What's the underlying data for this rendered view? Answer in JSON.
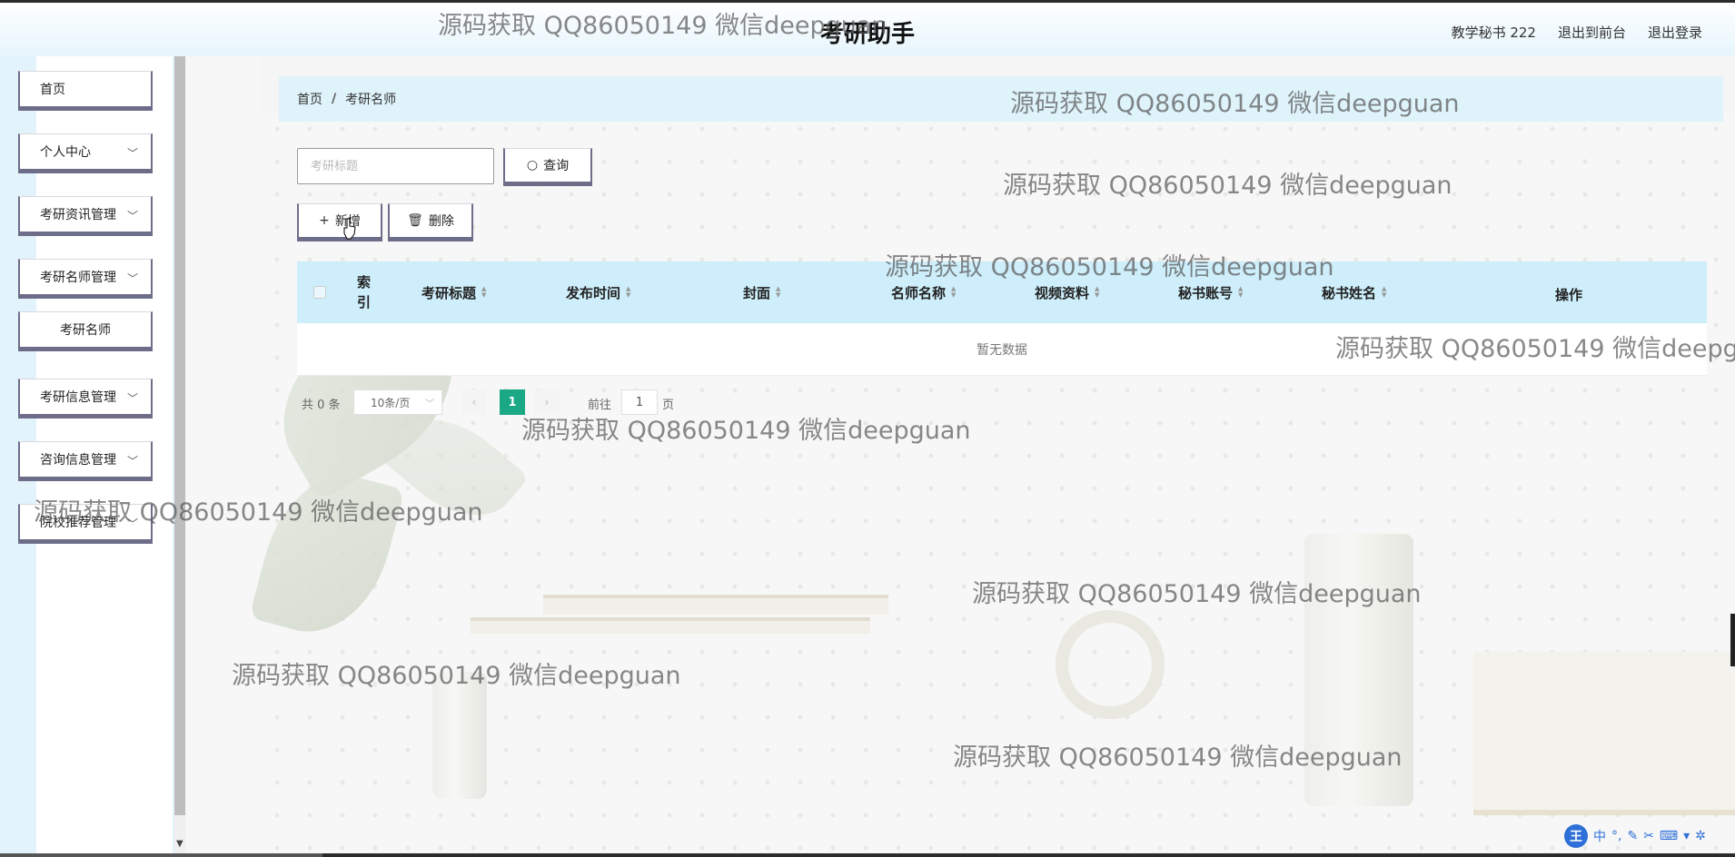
{
  "header": {
    "title": "考研助手",
    "user_label": "教学秘书 222",
    "back_to_front": "退出到前台",
    "logout": "退出登录"
  },
  "sidebar": {
    "items": [
      {
        "label": "首页",
        "has_children": false
      },
      {
        "label": "个人中心",
        "has_children": true
      },
      {
        "label": "考研资讯管理",
        "has_children": true
      },
      {
        "label": "考研名师管理",
        "has_children": true,
        "expanded": true
      },
      {
        "label": "考研名师",
        "is_subitem": true
      },
      {
        "label": "考研信息管理",
        "has_children": true
      },
      {
        "label": "咨询信息管理",
        "has_children": true
      },
      {
        "label": "院校推荐管理",
        "has_children": true
      }
    ]
  },
  "breadcrumb": {
    "items": [
      "首页",
      "考研名师"
    ],
    "separator": "/"
  },
  "search": {
    "placeholder": "考研标题",
    "value": "",
    "button_label": "查询",
    "button_icon": "search-icon"
  },
  "actions": {
    "add_label": "新增",
    "add_icon": "plus-icon",
    "delete_label": "删除",
    "delete_icon": "trash-icon"
  },
  "table": {
    "index_header": "索引",
    "columns": [
      "考研标题",
      "发布时间",
      "封面",
      "名师名称",
      "视频资料",
      "秘书账号",
      "秘书姓名",
      "操作"
    ],
    "rows": [],
    "empty_text": "暂无数据"
  },
  "pagination": {
    "total_label": "共 0 条",
    "page_size": "10条/页",
    "current_page": "1",
    "goto_label": "前往",
    "goto_value": "1",
    "page_unit": "页"
  },
  "watermark": "源码获取 QQ86050149 微信deepguan",
  "ime": {
    "logo": "王",
    "lang": "中"
  },
  "colors": {
    "header_gradient_end": "#e5f5fc",
    "breadcrumb_bg": "#dff3fb",
    "table_header_bg": "#cdeefa",
    "active_page": "#1aa885",
    "button_border": "#6d6d8a"
  }
}
